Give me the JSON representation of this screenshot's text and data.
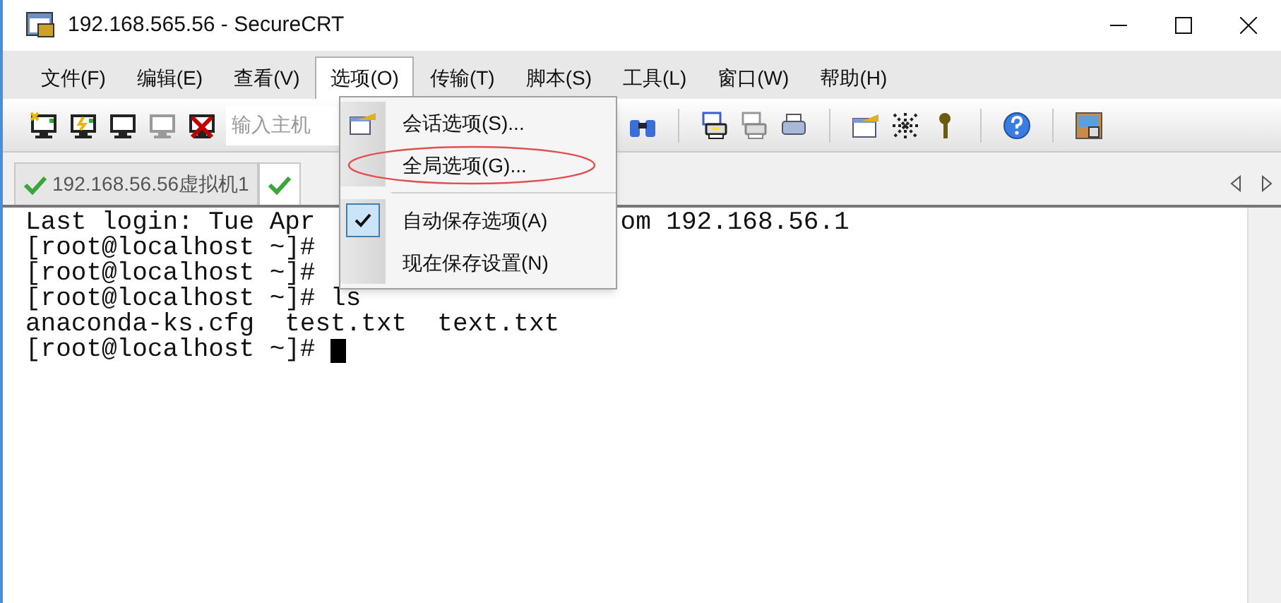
{
  "window": {
    "title": "192.168.565.56 - SecureCRT"
  },
  "menu_bar": [
    {
      "label": "文件(F)",
      "selected": false
    },
    {
      "label": "编辑(E)",
      "selected": false
    },
    {
      "label": "查看(V)",
      "selected": false
    },
    {
      "label": "选项(O)",
      "selected": true
    },
    {
      "label": "传输(T)",
      "selected": false
    },
    {
      "label": "脚本(S)",
      "selected": false
    },
    {
      "label": "工具(L)",
      "selected": false
    },
    {
      "label": "窗口(W)",
      "selected": false
    },
    {
      "label": "帮助(H)",
      "selected": false
    }
  ],
  "toolbar": {
    "host_field": {
      "placeholder": "输入主机"
    }
  },
  "tabs": [
    {
      "label": "192.168.56.56虚拟机1",
      "selected": false
    },
    {
      "selected": true
    }
  ],
  "dropdown_menu": {
    "items": [
      {
        "kind": "item",
        "label": "会话选项(S)...",
        "checked": false,
        "has_icon": true,
        "circled": false
      },
      {
        "kind": "item",
        "label": "全局选项(G)...",
        "checked": false,
        "has_icon": false,
        "circled": true
      },
      {
        "kind": "separator"
      },
      {
        "kind": "item",
        "label": "自动保存选项(A)",
        "checked": true,
        "has_icon": false,
        "circled": false
      },
      {
        "kind": "item",
        "label": "现在保存设置(N)",
        "checked": false,
        "has_icon": false,
        "circled": false
      }
    ]
  },
  "terminal": {
    "lines": [
      {
        "text": "Last login: Tue Apr",
        "continued": "om 192.168.56.1",
        "cursor": false
      },
      {
        "text": "[root@localhost ~]#",
        "cursor": false
      },
      {
        "text": "[root@localhost ~]#",
        "cursor": false
      },
      {
        "text": "[root@localhost ~]# ls",
        "cursor": false
      },
      {
        "text": "anaconda-ks.cfg  test.txt  text.txt",
        "cursor": false
      },
      {
        "text": "[root@localhost ~]# ",
        "cursor": true
      }
    ]
  }
}
